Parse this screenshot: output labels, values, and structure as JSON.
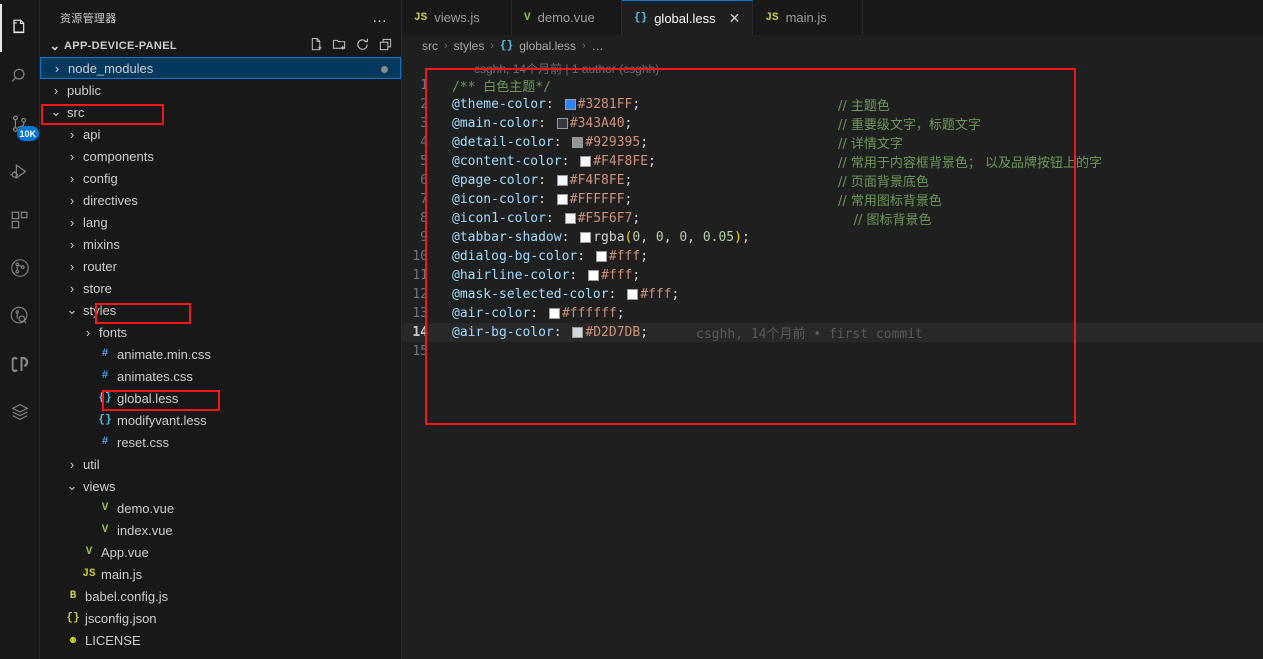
{
  "activitybar": {
    "items": [
      {
        "name": "explorer-icon",
        "label": "Explorer",
        "active": true,
        "badge": null
      },
      {
        "name": "search-icon",
        "label": "Search",
        "active": false,
        "badge": null
      },
      {
        "name": "source-control-icon",
        "label": "Source Control",
        "active": false,
        "badge": "10K"
      },
      {
        "name": "run-and-debug-icon",
        "label": "Run and Debug",
        "active": false,
        "badge": null
      },
      {
        "name": "extensions-icon",
        "label": "Extensions",
        "active": false,
        "badge": null
      },
      {
        "name": "git-graph-icon",
        "label": "Git Graph",
        "active": false,
        "badge": null
      },
      {
        "name": "git-history-icon",
        "label": "Git History",
        "active": false,
        "badge": null
      },
      {
        "name": "codestream-icon",
        "label": "CodeStream",
        "active": false,
        "badge": null
      },
      {
        "name": "project-manager-icon",
        "label": "Project Manager",
        "active": false,
        "badge": null
      }
    ]
  },
  "sidebar": {
    "title": "资源管理器",
    "more_actions": "…",
    "section": {
      "label": "APP-DEVICE-PANEL",
      "twisty": "⌄",
      "actions": [
        {
          "name": "new-file-icon",
          "label": "新建文件"
        },
        {
          "name": "new-folder-icon",
          "label": "新建文件夹"
        },
        {
          "name": "refresh-icon",
          "label": "刷新资源管理器"
        },
        {
          "name": "collapse-all-icon",
          "label": "在资源管理器中折叠文件夹"
        }
      ]
    },
    "tree": [
      {
        "label": "node_modules",
        "indent": 0,
        "kind": "folder",
        "twisty": "›",
        "selected": true,
        "trailing_dot": true
      },
      {
        "label": "public",
        "indent": 0,
        "kind": "folder",
        "twisty": "›",
        "selected": false,
        "trailing_dot": false
      },
      {
        "label": "src",
        "indent": 0,
        "kind": "folder",
        "twisty": "⌄",
        "selected": false,
        "trailing_dot": false
      },
      {
        "label": "api",
        "indent": 1,
        "kind": "folder",
        "twisty": "›",
        "selected": false,
        "trailing_dot": false
      },
      {
        "label": "components",
        "indent": 1,
        "kind": "folder",
        "twisty": "›",
        "selected": false,
        "trailing_dot": false
      },
      {
        "label": "config",
        "indent": 1,
        "kind": "folder",
        "twisty": "›",
        "selected": false,
        "trailing_dot": false
      },
      {
        "label": "directives",
        "indent": 1,
        "kind": "folder",
        "twisty": "›",
        "selected": false,
        "trailing_dot": false
      },
      {
        "label": "lang",
        "indent": 1,
        "kind": "folder",
        "twisty": "›",
        "selected": false,
        "trailing_dot": false
      },
      {
        "label": "mixins",
        "indent": 1,
        "kind": "folder",
        "twisty": "›",
        "selected": false,
        "trailing_dot": false
      },
      {
        "label": "router",
        "indent": 1,
        "kind": "folder",
        "twisty": "›",
        "selected": false,
        "trailing_dot": false
      },
      {
        "label": "store",
        "indent": 1,
        "kind": "folder",
        "twisty": "›",
        "selected": false,
        "trailing_dot": false
      },
      {
        "label": "styles",
        "indent": 1,
        "kind": "folder",
        "twisty": "⌄",
        "selected": false,
        "trailing_dot": false
      },
      {
        "label": "fonts",
        "indent": 2,
        "kind": "folder",
        "twisty": "›",
        "selected": false,
        "trailing_dot": false
      },
      {
        "label": "animate.min.css",
        "indent": 2,
        "kind": "css",
        "icon": "#",
        "selected": false,
        "trailing_dot": false
      },
      {
        "label": "animates.css",
        "indent": 2,
        "kind": "css",
        "icon": "#",
        "selected": false,
        "trailing_dot": false
      },
      {
        "label": "global.less",
        "indent": 2,
        "kind": "less",
        "icon": "{}",
        "selected": false,
        "trailing_dot": false
      },
      {
        "label": "modifyvant.less",
        "indent": 2,
        "kind": "less",
        "icon": "{}",
        "selected": false,
        "trailing_dot": false
      },
      {
        "label": "reset.css",
        "indent": 2,
        "kind": "css",
        "icon": "#",
        "selected": false,
        "trailing_dot": false
      },
      {
        "label": "util",
        "indent": 1,
        "kind": "folder",
        "twisty": "›",
        "selected": false,
        "trailing_dot": false
      },
      {
        "label": "views",
        "indent": 1,
        "kind": "folder",
        "twisty": "⌄",
        "selected": false,
        "trailing_dot": false
      },
      {
        "label": "demo.vue",
        "indent": 2,
        "kind": "vue",
        "icon": "V",
        "selected": false,
        "trailing_dot": false
      },
      {
        "label": "index.vue",
        "indent": 2,
        "kind": "vue",
        "icon": "V",
        "selected": false,
        "trailing_dot": false
      },
      {
        "label": "App.vue",
        "indent": 1,
        "kind": "vue",
        "icon": "V",
        "selected": false,
        "trailing_dot": false
      },
      {
        "label": "main.js",
        "indent": 1,
        "kind": "js",
        "icon": "JS",
        "selected": false,
        "trailing_dot": false
      },
      {
        "label": "babel.config.js",
        "indent": 0,
        "kind": "babel",
        "icon": "B",
        "selected": false,
        "trailing_dot": false
      },
      {
        "label": "jsconfig.json",
        "indent": 0,
        "kind": "json",
        "icon": "{}",
        "selected": false,
        "trailing_dot": false
      },
      {
        "label": "LICENSE",
        "indent": 0,
        "kind": "license",
        "icon": "⚉",
        "selected": false,
        "trailing_dot": false
      }
    ],
    "highlight_boxes": [
      {
        "name": "highlight-src",
        "target": "src"
      },
      {
        "name": "highlight-styles",
        "target": "styles"
      },
      {
        "name": "highlight-global-less",
        "target": "global.less"
      }
    ]
  },
  "editor": {
    "tabs": [
      {
        "label": "views.js",
        "icon": "JS",
        "icon_kind": "js",
        "active": false,
        "closable": false
      },
      {
        "label": "demo.vue",
        "icon": "V",
        "icon_kind": "vue",
        "active": false,
        "closable": false
      },
      {
        "label": "global.less",
        "icon": "{}",
        "icon_kind": "less",
        "active": true,
        "closable": true,
        "close": "✕"
      },
      {
        "label": "main.js",
        "icon": "JS",
        "icon_kind": "js",
        "active": false,
        "closable": false
      }
    ],
    "breadcrumb": [
      {
        "label": "src",
        "icon": null
      },
      {
        "label": "styles",
        "icon": null
      },
      {
        "label": "global.less",
        "icon": "{}"
      },
      {
        "label": "…",
        "icon": null
      }
    ],
    "breadcrumb_separator": "›",
    "blame_header": "csghh, 14个月前 | 1 author (csghh)",
    "inline_blame": "csghh, 14个月前 • first commit",
    "active_line": 14,
    "total_lines": 15,
    "lines": [
      {
        "n": 1,
        "tokens": [
          {
            "t": "/** 白色主题*/",
            "c": "tok-comment"
          }
        ],
        "comment": ""
      },
      {
        "n": 2,
        "tokens": [
          {
            "t": "@theme-color",
            "c": "tok-var"
          },
          {
            "t": ": ",
            "c": "tok-punc"
          },
          {
            "sw": "#3281FF"
          },
          {
            "t": "#3281FF",
            "c": "tok-num"
          },
          {
            "t": ";",
            "c": "tok-punc"
          }
        ],
        "comment": "// 主题色",
        "comment_col": 50
      },
      {
        "n": 3,
        "tokens": [
          {
            "t": "@main-color",
            "c": "tok-var"
          },
          {
            "t": ": ",
            "c": "tok-punc"
          },
          {
            "sw": "#343A40"
          },
          {
            "t": "#343A40",
            "c": "tok-num"
          },
          {
            "t": ";",
            "c": "tok-punc"
          }
        ],
        "comment": "// 重要级文字，标题文字",
        "comment_col": 50
      },
      {
        "n": 4,
        "tokens": [
          {
            "t": "@detail-color",
            "c": "tok-var"
          },
          {
            "t": ": ",
            "c": "tok-punc"
          },
          {
            "sw": "#929395"
          },
          {
            "t": "#929395",
            "c": "tok-num"
          },
          {
            "t": ";",
            "c": "tok-punc"
          }
        ],
        "comment": "// 详情文字",
        "comment_col": 50
      },
      {
        "n": 5,
        "tokens": [
          {
            "t": "@content-color",
            "c": "tok-var"
          },
          {
            "t": ": ",
            "c": "tok-punc"
          },
          {
            "sw": "#F4F8FE"
          },
          {
            "t": "#F4F8FE",
            "c": "tok-num"
          },
          {
            "t": ";",
            "c": "tok-punc"
          }
        ],
        "comment": "// 常用于内容框背景色； 以及品牌按钮上的字",
        "comment_col": 50
      },
      {
        "n": 6,
        "tokens": [
          {
            "t": "@page-color",
            "c": "tok-var"
          },
          {
            "t": ": ",
            "c": "tok-punc"
          },
          {
            "sw": "#F4F8FE"
          },
          {
            "t": "#F4F8FE",
            "c": "tok-num"
          },
          {
            "t": ";",
            "c": "tok-punc"
          }
        ],
        "comment": "// 页面背景底色",
        "comment_col": 50
      },
      {
        "n": 7,
        "tokens": [
          {
            "t": "@icon-color",
            "c": "tok-var"
          },
          {
            "t": ": ",
            "c": "tok-punc"
          },
          {
            "sw": "#FFFFFF"
          },
          {
            "t": "#FFFFFF",
            "c": "tok-num"
          },
          {
            "t": ";",
            "c": "tok-punc"
          }
        ],
        "comment": "// 常用图标背景色",
        "comment_col": 50
      },
      {
        "n": 8,
        "tokens": [
          {
            "t": "@icon1-color",
            "c": "tok-var"
          },
          {
            "t": ": ",
            "c": "tok-punc"
          },
          {
            "sw": "#F5F6F7"
          },
          {
            "t": "#F5F6F7",
            "c": "tok-num"
          },
          {
            "t": ";",
            "c": "tok-punc"
          }
        ],
        "comment": "// 图标背景色",
        "comment_col": 52
      },
      {
        "n": 9,
        "tokens": [
          {
            "t": "@tabbar-shadow",
            "c": "tok-var"
          },
          {
            "t": ": ",
            "c": "tok-punc"
          },
          {
            "sw": "#FFFFFF"
          },
          {
            "t": "rgba",
            "c": "tok-punc"
          },
          {
            "t": "(",
            "c": "tok-paren"
          },
          {
            "t": "0",
            "c": "tok-digit"
          },
          {
            "t": ", ",
            "c": "tok-punc"
          },
          {
            "t": "0",
            "c": "tok-digit"
          },
          {
            "t": ", ",
            "c": "tok-punc"
          },
          {
            "t": "0",
            "c": "tok-digit"
          },
          {
            "t": ", ",
            "c": "tok-punc"
          },
          {
            "t": "0.05",
            "c": "tok-digit"
          },
          {
            "t": ")",
            "c": "tok-paren"
          },
          {
            "t": ";",
            "c": "tok-punc"
          }
        ],
        "comment": ""
      },
      {
        "n": 10,
        "tokens": [
          {
            "t": "@dialog-bg-color",
            "c": "tok-var"
          },
          {
            "t": ": ",
            "c": "tok-punc"
          },
          {
            "sw": "#ffffff"
          },
          {
            "t": "#fff",
            "c": "tok-num"
          },
          {
            "t": ";",
            "c": "tok-punc"
          }
        ],
        "comment": ""
      },
      {
        "n": 11,
        "tokens": [
          {
            "t": "@hairline-color",
            "c": "tok-var"
          },
          {
            "t": ": ",
            "c": "tok-punc"
          },
          {
            "sw": "#ffffff"
          },
          {
            "t": "#fff",
            "c": "tok-num"
          },
          {
            "t": ";",
            "c": "tok-punc"
          }
        ],
        "comment": ""
      },
      {
        "n": 12,
        "tokens": [
          {
            "t": "@mask-selected-color",
            "c": "tok-var"
          },
          {
            "t": ": ",
            "c": "tok-punc"
          },
          {
            "sw": "#ffffff"
          },
          {
            "t": "#fff",
            "c": "tok-num"
          },
          {
            "t": ";",
            "c": "tok-punc"
          }
        ],
        "comment": ""
      },
      {
        "n": 13,
        "tokens": [
          {
            "t": "@air-color",
            "c": "tok-var"
          },
          {
            "t": ": ",
            "c": "tok-punc"
          },
          {
            "sw": "#ffffff"
          },
          {
            "t": "#ffffff",
            "c": "tok-num"
          },
          {
            "t": ";",
            "c": "tok-punc"
          }
        ],
        "comment": ""
      },
      {
        "n": 14,
        "tokens": [
          {
            "t": "@air-bg-color",
            "c": "tok-var"
          },
          {
            "t": ": ",
            "c": "tok-punc"
          },
          {
            "sw": "#D2D7DB"
          },
          {
            "t": "#D2D7DB",
            "c": "tok-num"
          },
          {
            "t": ";",
            "c": "tok-punc"
          }
        ],
        "comment": "",
        "blame": true
      },
      {
        "n": 15,
        "tokens": [],
        "comment": ""
      }
    ],
    "highlight_box": {
      "name": "highlight-code-region"
    }
  },
  "colors": {
    "accent": "#0078d4",
    "annotation_red": "#f51616",
    "selection_bg": "#04395e",
    "editor_bg": "#1f1f1f",
    "sidebar_bg": "#181818"
  }
}
